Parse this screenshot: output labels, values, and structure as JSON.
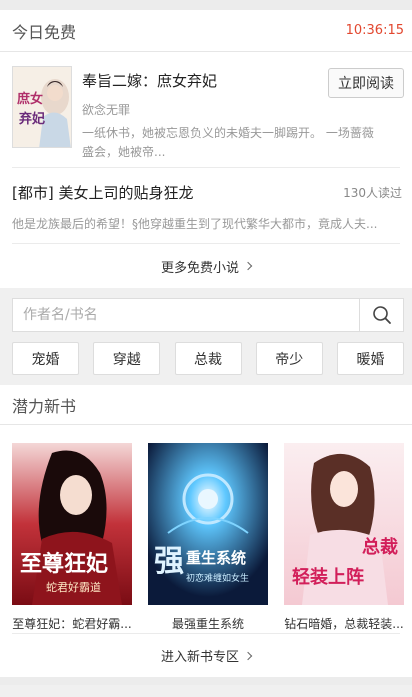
{
  "free_today": {
    "title": "今日免费",
    "countdown": "10:36:15",
    "featured": {
      "title": "奉旨二嫁：庶女弃妃",
      "author": "欲念无罪",
      "description": "一纸休书，她被忘恩负义的未婚夫一脚踢开。 一场蔷薇盛会，她被帝...",
      "button_label": "立即阅读",
      "cover_text": "庶女弃妃"
    },
    "text_book": {
      "title": "[都市] 美女上司的贴身狂龙",
      "readers": "130人读过",
      "description": "他是龙族最后的希望！§他穿越重生到了现代繁华大都市，竟成人夫..."
    },
    "more_label": "更多免费小说"
  },
  "search": {
    "placeholder": "作者名/书名"
  },
  "tags": [
    "宠婚",
    "穿越",
    "总裁",
    "帝少",
    "暖婚"
  ],
  "new_books": {
    "title": "潜力新书",
    "books": [
      {
        "title": "至尊狂妃：蛇君好霸...",
        "cover_text": "至尊狂妃",
        "cover_sub": "蛇君好霸道"
      },
      {
        "title": "最强重生系统",
        "cover_text": "重生系统",
        "cover_sub": "初恋难缠如女生"
      },
      {
        "title": "钻石暗婚，总裁轻装...",
        "cover_text": "总裁",
        "cover_sub": "轻装上阵"
      }
    ],
    "enter_label": "进入新书专区"
  },
  "colors": {
    "accent": "#e2472f",
    "border": "#dddddd"
  }
}
